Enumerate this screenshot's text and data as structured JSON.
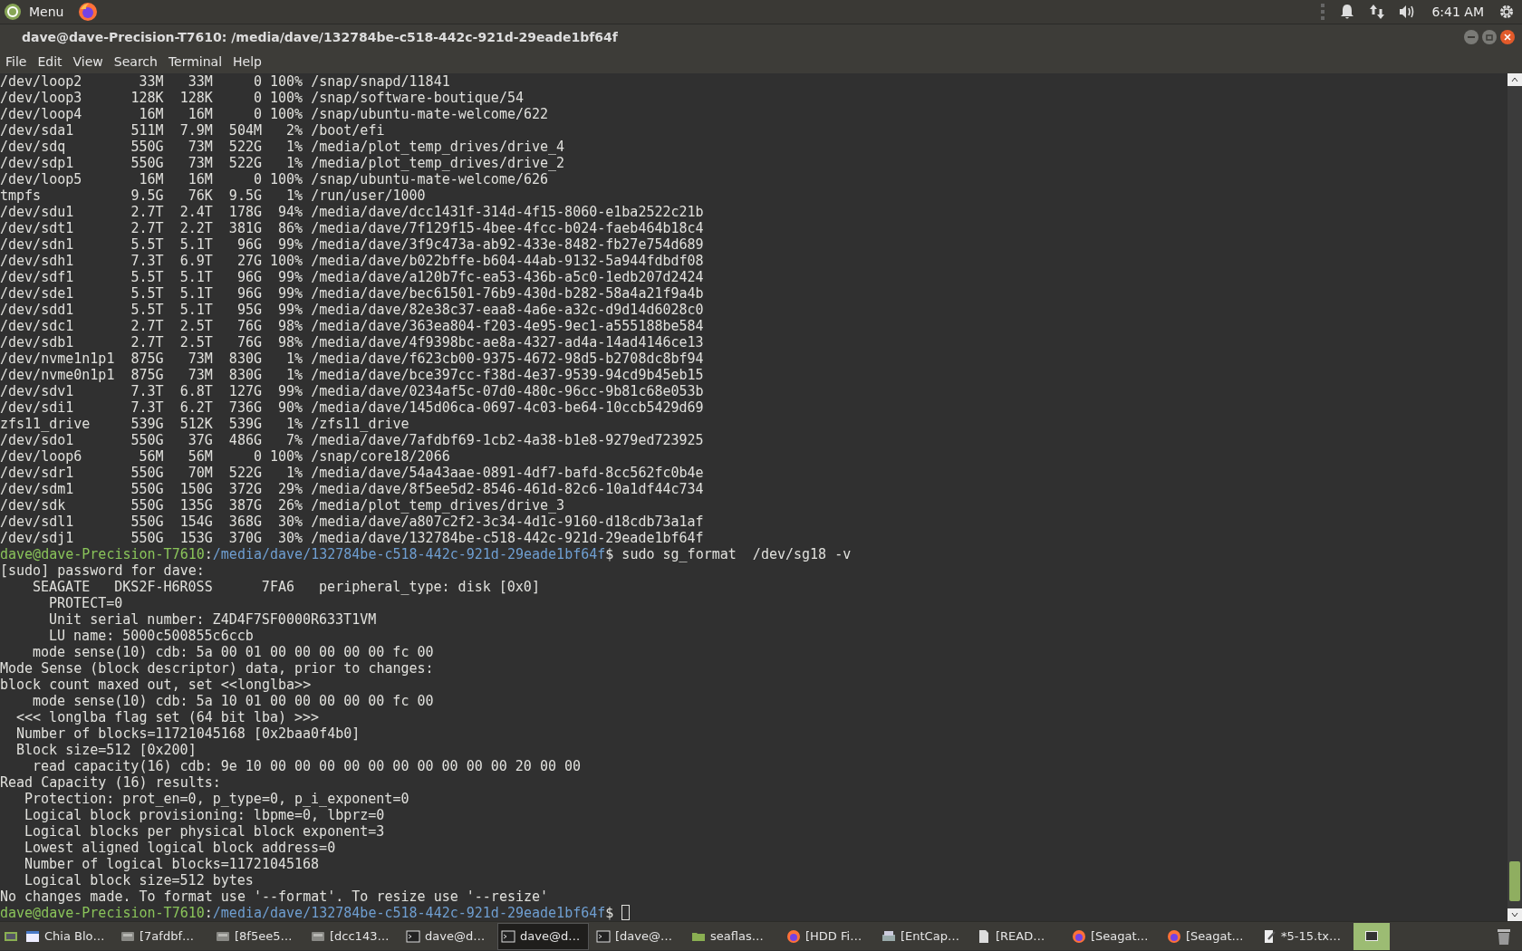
{
  "top_panel": {
    "menu_label": "Menu",
    "clock": "6:41 AM"
  },
  "window": {
    "title": "dave@dave-Precision-T7610: /media/dave/132784be-c518-442c-921d-29eade1bf64f"
  },
  "menu": [
    "File",
    "Edit",
    "View",
    "Search",
    "Terminal",
    "Help"
  ],
  "terminal_lines": [
    {
      "kind": "df",
      "cols": [
        "/dev/loop2",
        "33M",
        "33M",
        "0",
        "100%",
        "/snap/snapd/11841"
      ]
    },
    {
      "kind": "df",
      "cols": [
        "/dev/loop3",
        "128K",
        "128K",
        "0",
        "100%",
        "/snap/software-boutique/54"
      ]
    },
    {
      "kind": "df",
      "cols": [
        "/dev/loop4",
        "16M",
        "16M",
        "0",
        "100%",
        "/snap/ubuntu-mate-welcome/622"
      ]
    },
    {
      "kind": "df",
      "cols": [
        "/dev/sda1",
        "511M",
        "7.9M",
        "504M",
        "2%",
        "/boot/efi"
      ]
    },
    {
      "kind": "df",
      "cols": [
        "/dev/sdq",
        "550G",
        "73M",
        "522G",
        "1%",
        "/media/plot_temp_drives/drive_4"
      ]
    },
    {
      "kind": "df",
      "cols": [
        "/dev/sdp1",
        "550G",
        "73M",
        "522G",
        "1%",
        "/media/plot_temp_drives/drive_2"
      ]
    },
    {
      "kind": "df",
      "cols": [
        "/dev/loop5",
        "16M",
        "16M",
        "0",
        "100%",
        "/snap/ubuntu-mate-welcome/626"
      ]
    },
    {
      "kind": "df",
      "cols": [
        "tmpfs",
        "9.5G",
        "76K",
        "9.5G",
        "1%",
        "/run/user/1000"
      ]
    },
    {
      "kind": "df",
      "cols": [
        "/dev/sdu1",
        "2.7T",
        "2.4T",
        "178G",
        "94%",
        "/media/dave/dcc1431f-314d-4f15-8060-e1ba2522c21b"
      ]
    },
    {
      "kind": "df",
      "cols": [
        "/dev/sdt1",
        "2.7T",
        "2.2T",
        "381G",
        "86%",
        "/media/dave/7f129f15-4bee-4fcc-b024-faeb464b18c4"
      ]
    },
    {
      "kind": "df",
      "cols": [
        "/dev/sdn1",
        "5.5T",
        "5.1T",
        "96G",
        "99%",
        "/media/dave/3f9c473a-ab92-433e-8482-fb27e754d689"
      ]
    },
    {
      "kind": "df",
      "cols": [
        "/dev/sdh1",
        "7.3T",
        "6.9T",
        "27G",
        "100%",
        "/media/dave/b022bffe-b604-44ab-9132-5a944fdbdf08"
      ]
    },
    {
      "kind": "df",
      "cols": [
        "/dev/sdf1",
        "5.5T",
        "5.1T",
        "96G",
        "99%",
        "/media/dave/a120b7fc-ea53-436b-a5c0-1edb207d2424"
      ]
    },
    {
      "kind": "df",
      "cols": [
        "/dev/sde1",
        "5.5T",
        "5.1T",
        "96G",
        "99%",
        "/media/dave/bec61501-76b9-430d-b282-58a4a21f9a4b"
      ]
    },
    {
      "kind": "df",
      "cols": [
        "/dev/sdd1",
        "5.5T",
        "5.1T",
        "95G",
        "99%",
        "/media/dave/82e38c37-eaa8-4a6e-a32c-d9d14d6028c0"
      ]
    },
    {
      "kind": "df",
      "cols": [
        "/dev/sdc1",
        "2.7T",
        "2.5T",
        "76G",
        "98%",
        "/media/dave/363ea804-f203-4e95-9ec1-a555188be584"
      ]
    },
    {
      "kind": "df",
      "cols": [
        "/dev/sdb1",
        "2.7T",
        "2.5T",
        "76G",
        "98%",
        "/media/dave/4f9398bc-ae8a-4327-ad4a-14ad4146ce13"
      ]
    },
    {
      "kind": "df",
      "cols": [
        "/dev/nvme1n1p1",
        "875G",
        "73M",
        "830G",
        "1%",
        "/media/dave/f623cb00-9375-4672-98d5-b2708dc8bf94"
      ]
    },
    {
      "kind": "df",
      "cols": [
        "/dev/nvme0n1p1",
        "875G",
        "73M",
        "830G",
        "1%",
        "/media/dave/bce397cc-f38d-4e37-9539-94cd9b45eb15"
      ]
    },
    {
      "kind": "df",
      "cols": [
        "/dev/sdv1",
        "7.3T",
        "6.8T",
        "127G",
        "99%",
        "/media/dave/0234af5c-07d0-480c-96cc-9b81c68e053b"
      ]
    },
    {
      "kind": "df",
      "cols": [
        "/dev/sdi1",
        "7.3T",
        "6.2T",
        "736G",
        "90%",
        "/media/dave/145d06ca-0697-4c03-be64-10ccb5429d69"
      ]
    },
    {
      "kind": "df",
      "cols": [
        "zfs11_drive",
        "539G",
        "512K",
        "539G",
        "1%",
        "/zfs11_drive"
      ]
    },
    {
      "kind": "df",
      "cols": [
        "/dev/sdo1",
        "550G",
        "37G",
        "486G",
        "7%",
        "/media/dave/7afdbf69-1cb2-4a38-b1e8-9279ed723925"
      ]
    },
    {
      "kind": "df",
      "cols": [
        "/dev/loop6",
        "56M",
        "56M",
        "0",
        "100%",
        "/snap/core18/2066"
      ]
    },
    {
      "kind": "df",
      "cols": [
        "/dev/sdr1",
        "550G",
        "70M",
        "522G",
        "1%",
        "/media/dave/54a43aae-0891-4df7-bafd-8cc562fc0b4e"
      ]
    },
    {
      "kind": "df",
      "cols": [
        "/dev/sdm1",
        "550G",
        "150G",
        "372G",
        "29%",
        "/media/dave/8f5ee5d2-8546-461d-82c6-10a1df44c734"
      ]
    },
    {
      "kind": "df",
      "cols": [
        "/dev/sdk",
        "550G",
        "135G",
        "387G",
        "26%",
        "/media/plot_temp_drives/drive_3"
      ]
    },
    {
      "kind": "df",
      "cols": [
        "/dev/sdl1",
        "550G",
        "154G",
        "368G",
        "30%",
        "/media/dave/a807c2f2-3c34-4d1c-9160-d18cdb73a1af"
      ]
    },
    {
      "kind": "df",
      "cols": [
        "/dev/sdj1",
        "550G",
        "153G",
        "370G",
        "30%",
        "/media/dave/132784be-c518-442c-921d-29eade1bf64f"
      ]
    },
    {
      "kind": "prompt",
      "user_host": "dave@dave-Precision-T7610",
      "separator": ":",
      "path": "/media/dave/132784be-c518-442c-921d-29eade1bf64f",
      "command": "$ sudo sg_format  /dev/sg18 -v",
      "cursor": false
    },
    {
      "kind": "text",
      "text": "[sudo] password for dave:"
    },
    {
      "kind": "text",
      "text": "    SEAGATE   DKS2F-H6R0SS      7FA6   peripheral_type: disk [0x0]"
    },
    {
      "kind": "text",
      "text": "      PROTECT=0"
    },
    {
      "kind": "text",
      "text": "      Unit serial number: Z4D4F7SF0000R633T1VM"
    },
    {
      "kind": "text",
      "text": "      LU name: 5000c500855c6ccb"
    },
    {
      "kind": "text",
      "text": "    mode sense(10) cdb: 5a 00 01 00 00 00 00 00 fc 00"
    },
    {
      "kind": "text",
      "text": "Mode Sense (block descriptor) data, prior to changes:"
    },
    {
      "kind": "text",
      "text": "block count maxed out, set <<longlba>>"
    },
    {
      "kind": "text",
      "text": "    mode sense(10) cdb: 5a 10 01 00 00 00 00 00 fc 00"
    },
    {
      "kind": "text",
      "text": "  <<< longlba flag set (64 bit lba) >>>"
    },
    {
      "kind": "text",
      "text": "  Number of blocks=11721045168 [0x2baa0f4b0]"
    },
    {
      "kind": "text",
      "text": "  Block size=512 [0x200]"
    },
    {
      "kind": "text",
      "text": "    read capacity(16) cdb: 9e 10 00 00 00 00 00 00 00 00 00 00 20 00 00"
    },
    {
      "kind": "text",
      "text": "Read Capacity (16) results:"
    },
    {
      "kind": "text",
      "text": "   Protection: prot_en=0, p_type=0, p_i_exponent=0"
    },
    {
      "kind": "text",
      "text": "   Logical block provisioning: lbpme=0, lbprz=0"
    },
    {
      "kind": "text",
      "text": "   Logical blocks per physical block exponent=3"
    },
    {
      "kind": "text",
      "text": "   Lowest aligned logical block address=0"
    },
    {
      "kind": "text",
      "text": "   Number of logical blocks=11721045168"
    },
    {
      "kind": "text",
      "text": "   Logical block size=512 bytes"
    },
    {
      "kind": "text",
      "text": "No changes made. To format use '--format'. To resize use '--resize'"
    },
    {
      "kind": "prompt",
      "user_host": "dave@dave-Precision-T7610",
      "separator": ":",
      "path": "/media/dave/132784be-c518-442c-921d-29eade1bf64f",
      "command": "$",
      "cursor": true
    }
  ],
  "taskbar": [
    {
      "kind": "window",
      "label": "Chia Blo…",
      "selected": false
    },
    {
      "kind": "drive",
      "label": "[7afdbf…",
      "selected": false
    },
    {
      "kind": "drive",
      "label": "[8f5ee5…",
      "selected": false
    },
    {
      "kind": "drive",
      "label": "[dcc143…",
      "selected": false
    },
    {
      "kind": "terminal",
      "label": "dave@d…",
      "selected": false
    },
    {
      "kind": "terminal",
      "label": "dave@d…",
      "selected": true
    },
    {
      "kind": "terminal",
      "label": "[dave@…",
      "selected": false
    },
    {
      "kind": "folder",
      "label": "seaflas…",
      "selected": false
    },
    {
      "kind": "firefox",
      "label": "[HDD Fi…",
      "selected": false
    },
    {
      "kind": "scanner",
      "label": "[EntCap…",
      "selected": false
    },
    {
      "kind": "document",
      "label": "[READ…",
      "selected": false
    },
    {
      "kind": "firefox",
      "label": "[Seagat…",
      "selected": false
    },
    {
      "kind": "firefox",
      "label": "[Seagat…",
      "selected": false
    },
    {
      "kind": "editor",
      "label": "*5-15.tx…",
      "selected": false
    }
  ],
  "workspaces": [
    {
      "selected": true
    }
  ]
}
